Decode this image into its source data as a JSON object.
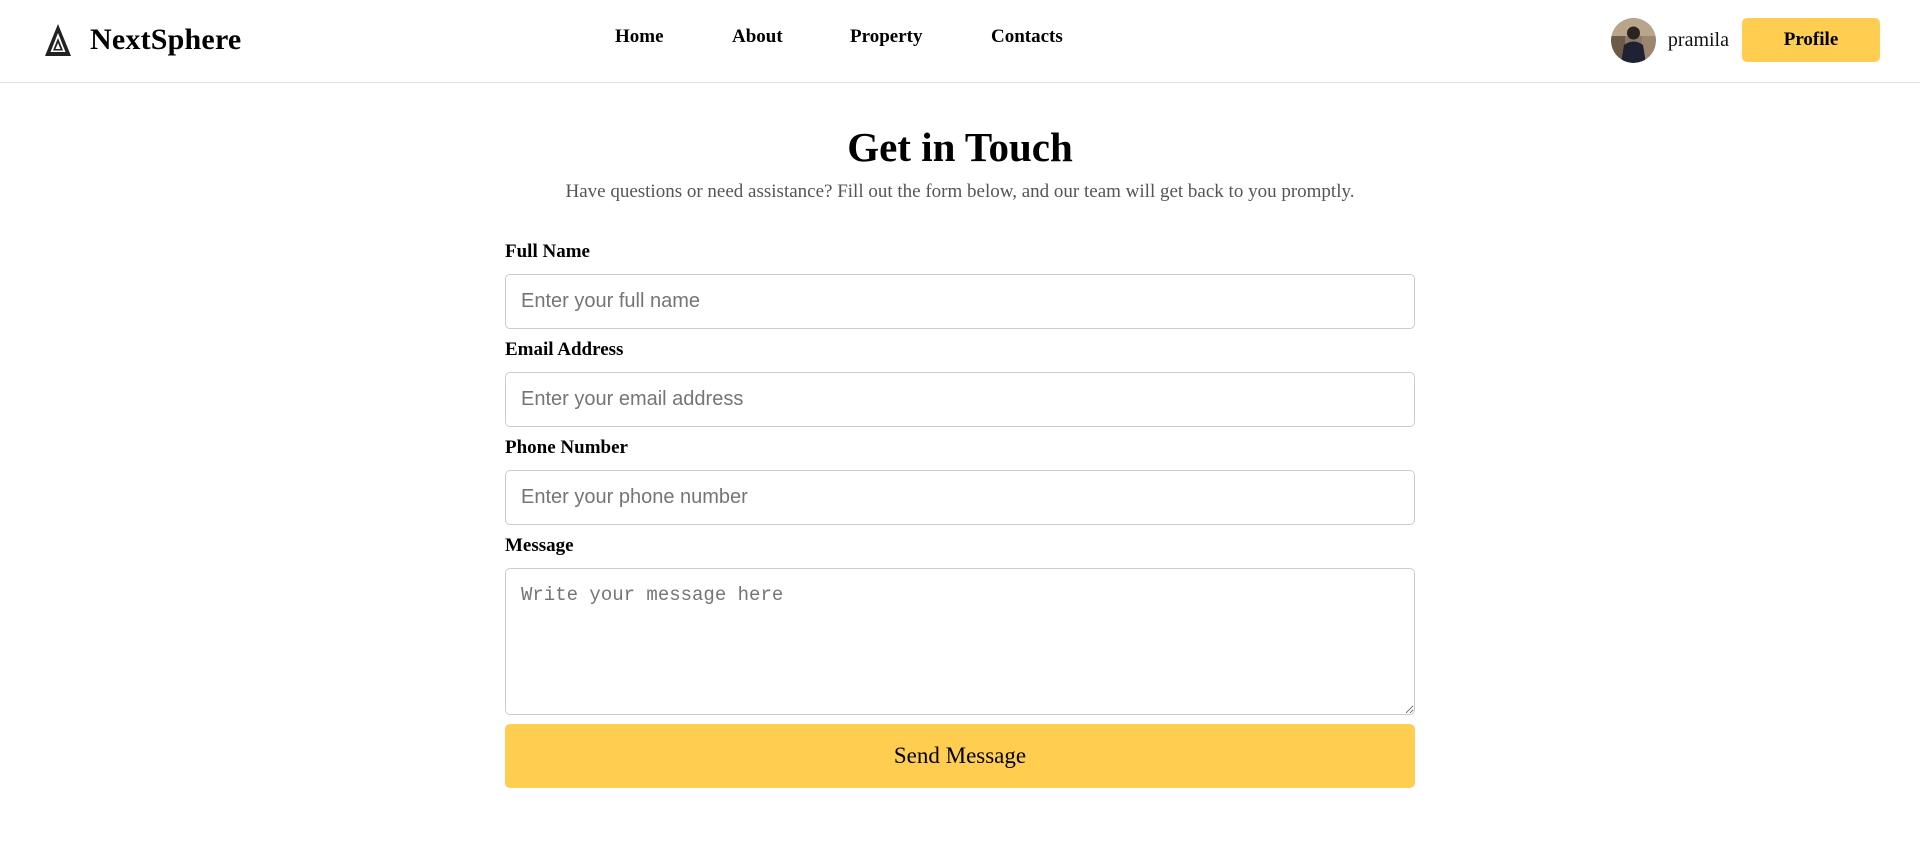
{
  "header": {
    "brand_name": "NextSphere",
    "logo_icon": "triangle-logo-icon",
    "nav": {
      "home": "Home",
      "about": "About",
      "property": "Property",
      "contacts": "Contacts"
    },
    "user": {
      "name": "pramila",
      "avatar_icon": "user-avatar"
    },
    "profile_button": "Profile"
  },
  "main": {
    "title": "Get in Touch",
    "subtitle": "Have questions or need assistance? Fill out the form below, and our team will get back to you promptly.",
    "form": {
      "full_name": {
        "label": "Full Name",
        "placeholder": "Enter your full name",
        "value": ""
      },
      "email": {
        "label": "Email Address",
        "placeholder": "Enter your email address",
        "value": ""
      },
      "phone": {
        "label": "Phone Number",
        "placeholder": "Enter your phone number",
        "value": ""
      },
      "message": {
        "label": "Message",
        "placeholder": "Write your message here",
        "value": ""
      },
      "submit_label": "Send Message"
    }
  },
  "colors": {
    "accent": "#ffcd4f",
    "border": "#cccccc",
    "subtitle": "#555555",
    "divider": "#e2e2e2"
  }
}
